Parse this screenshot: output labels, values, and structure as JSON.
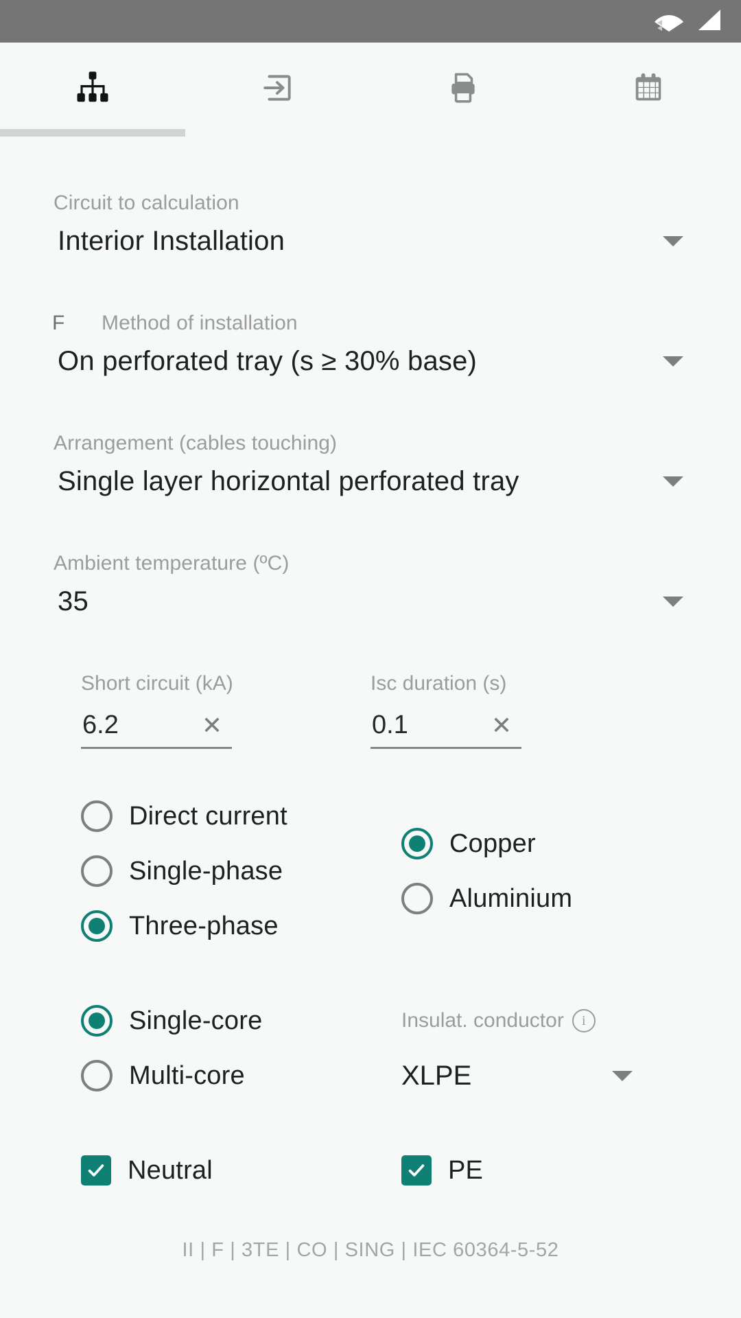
{
  "status_bar": {
    "background": "#757575",
    "icons": [
      "wifi-icon",
      "signal-icon"
    ]
  },
  "tabs": [
    {
      "name": "tab-circuit-diagram",
      "icon": "sitemap-icon",
      "active": true
    },
    {
      "name": "tab-input",
      "icon": "login-arrow-icon",
      "active": false
    },
    {
      "name": "tab-print",
      "icon": "printer-icon",
      "active": false
    },
    {
      "name": "tab-tables",
      "icon": "calendar-icon",
      "active": false
    }
  ],
  "theme": {
    "accent": "#0e8074",
    "page_bg": "#f7f8f8",
    "label_gray": "#9a9c9e",
    "value_black": "#1d1f20",
    "indicator_gray": "#d2d3d4"
  },
  "form": {
    "circuit": {
      "label": "Circuit to calculation",
      "value": "Interior Installation"
    },
    "method": {
      "prefix": "F",
      "label": "Method of installation",
      "value": "On perforated tray (s ≥ 30% base)"
    },
    "arrangement": {
      "label": "Arrangement (cables touching)",
      "value": "Single layer horizontal perforated tray"
    },
    "ambient": {
      "label": "Ambient temperature (ºC)",
      "value": "35"
    },
    "short_circuit": {
      "label": "Short circuit (kA)",
      "value": "6.2",
      "clear": "✕"
    },
    "isc_duration": {
      "label": "Isc duration (s)",
      "value": "0.1",
      "clear": "✕"
    },
    "current_type": {
      "options": [
        {
          "label": "Direct current",
          "selected": false
        },
        {
          "label": "Single-phase",
          "selected": false
        },
        {
          "label": "Three-phase",
          "selected": true
        }
      ]
    },
    "material": {
      "options": [
        {
          "label": "Copper",
          "selected": true
        },
        {
          "label": "Aluminium",
          "selected": false
        }
      ]
    },
    "core": {
      "options": [
        {
          "label": "Single-core",
          "selected": true
        },
        {
          "label": "Multi-core",
          "selected": false
        }
      ]
    },
    "insulation": {
      "label": "Insulat. conductor",
      "info": "i",
      "value": "XLPE"
    },
    "neutral": {
      "label": "Neutral",
      "checked": true
    },
    "pe": {
      "label": "PE",
      "checked": true
    }
  },
  "footer": {
    "summary": "II | F | 3TE | CO | SING | IEC 60364-5-52"
  }
}
